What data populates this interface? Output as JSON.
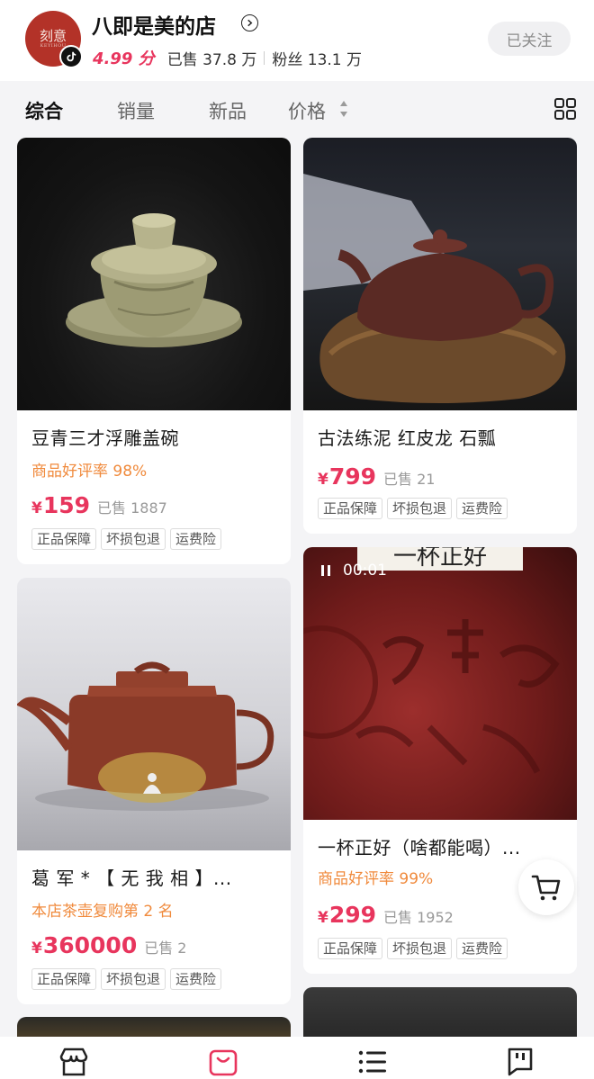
{
  "shop": {
    "name": "八即是美的店",
    "logo_text": "刻意",
    "logo_sub": "KEYIHOU",
    "score": "4.99 分",
    "sold": "已售 37.8 万",
    "fans": "粉丝 13.1 万",
    "follow_label": "已关注",
    "platform_icon": "tiktok-icon",
    "colors": {
      "accent": "#e8355d",
      "promo": "#f08a3c"
    }
  },
  "sort": {
    "tabs": [
      "综合",
      "销量",
      "新品",
      "价格"
    ],
    "active": "综合"
  },
  "products": [
    {
      "title": "豆青三才浮雕盖碗",
      "subline": "商品好评率 98%",
      "price": "159",
      "sold": "已售 1887",
      "tags": [
        "正品保障",
        "坏损包退",
        "运费险"
      ]
    },
    {
      "title": "古法练泥 红皮龙 石瓢",
      "price": "799",
      "sold": "已售 21",
      "tags": [
        "正品保障",
        "坏损包退",
        "运费险"
      ]
    },
    {
      "title": "葛 军 * 【 无 我 相 】...",
      "subline": "本店茶壶复购第 2 名",
      "price": "360000",
      "sold": "已售 2",
      "tags": [
        "正品保障",
        "坏损包退",
        "运费险"
      ]
    },
    {
      "title": "一杯正好（啥都能喝）...",
      "subline": "商品好评率 99%",
      "price": "299",
      "sold": "已售 1952",
      "tags": [
        "正品保障",
        "坏损包退",
        "运费险"
      ],
      "video_time": "00:01",
      "video_banner": "一杯正好"
    }
  ],
  "currency": "¥",
  "bottom_nav": [
    "store-icon",
    "shopping-bag-icon",
    "list-icon",
    "chat-icon"
  ]
}
